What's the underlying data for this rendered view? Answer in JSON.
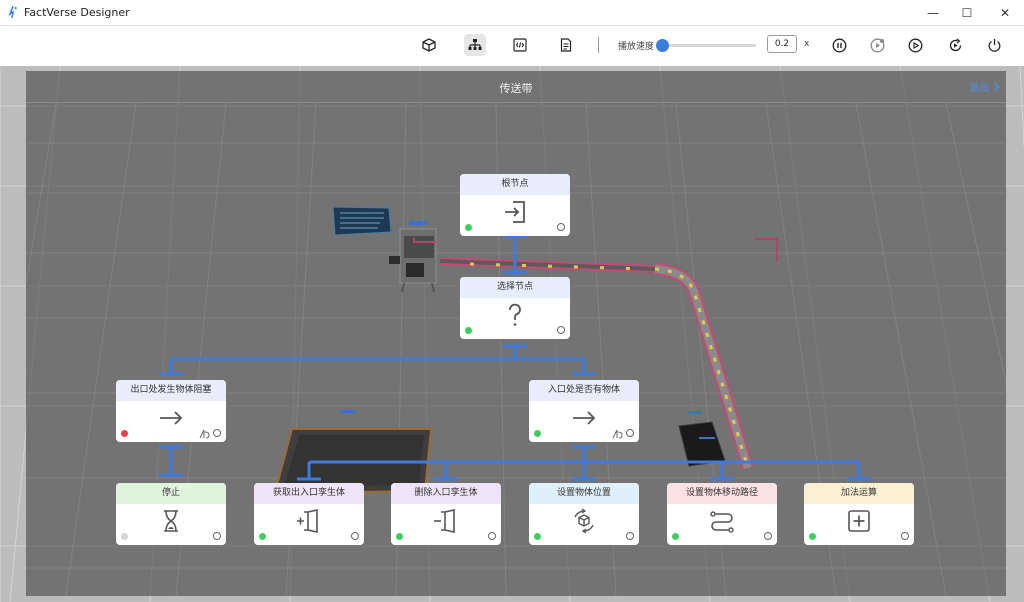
{
  "window": {
    "title": "FactVerse Designer",
    "minimize": "—",
    "maximize": "☐",
    "close": "✕"
  },
  "toolbar": {
    "buttons": [
      "cube-icon",
      "hierarchy-icon",
      "code-icon",
      "document-icon"
    ],
    "speed_label": "播放速度",
    "speed_value": "0.2",
    "speed_unit": "x",
    "speed_slider_fraction": 0.02,
    "controls": [
      "pause-icon",
      "step-icon",
      "play-icon",
      "reset-icon",
      "power-icon"
    ]
  },
  "panel": {
    "title": "传送带",
    "link": "退出"
  },
  "colors": {
    "accent": "#3b7ddd",
    "connector": "#3d7be0",
    "status_green": "#3ccf5f",
    "status_red": "#e8404a",
    "status_gray": "#d4d4d4"
  },
  "nodes": {
    "root": {
      "label": "根节点",
      "icon": "enter-icon",
      "header_color": "#e7edfa",
      "status": "green"
    },
    "select": {
      "label": "选择节点",
      "icon": "question-icon",
      "header_color": "#e7edfa",
      "status": "green"
    },
    "exit_blocked": {
      "label": "出口处发生物体阻塞",
      "icon": "arrow-right-icon",
      "header_color": "#e7edfa",
      "status": "red"
    },
    "entry_has": {
      "label": "入口处是否有物体",
      "icon": "arrow-right-icon",
      "header_color": "#e7edfa",
      "status": "green"
    },
    "stop": {
      "label": "停止",
      "icon": "hourglass-icon",
      "header_color": "#dff3dd",
      "status": "gray"
    },
    "get_twin": {
      "label": "获取出入口孪生体",
      "icon": "get-door-icon",
      "header_color": "#efe4f7",
      "status": "green"
    },
    "delete_twin": {
      "label": "删除入口孪生体",
      "icon": "delete-door-icon",
      "header_color": "#efe4f7",
      "status": "green"
    },
    "set_pos": {
      "label": "设置物体位置",
      "icon": "rotate-cube-icon",
      "header_color": "#e0f0fb",
      "status": "green"
    },
    "set_path": {
      "label": "设置物体移动路径",
      "icon": "path-icon",
      "header_color": "#fbe2e2",
      "status": "green"
    },
    "add": {
      "label": "加法运算",
      "icon": "plus-box-icon",
      "header_color": "#fcf0d3",
      "status": "green"
    }
  }
}
